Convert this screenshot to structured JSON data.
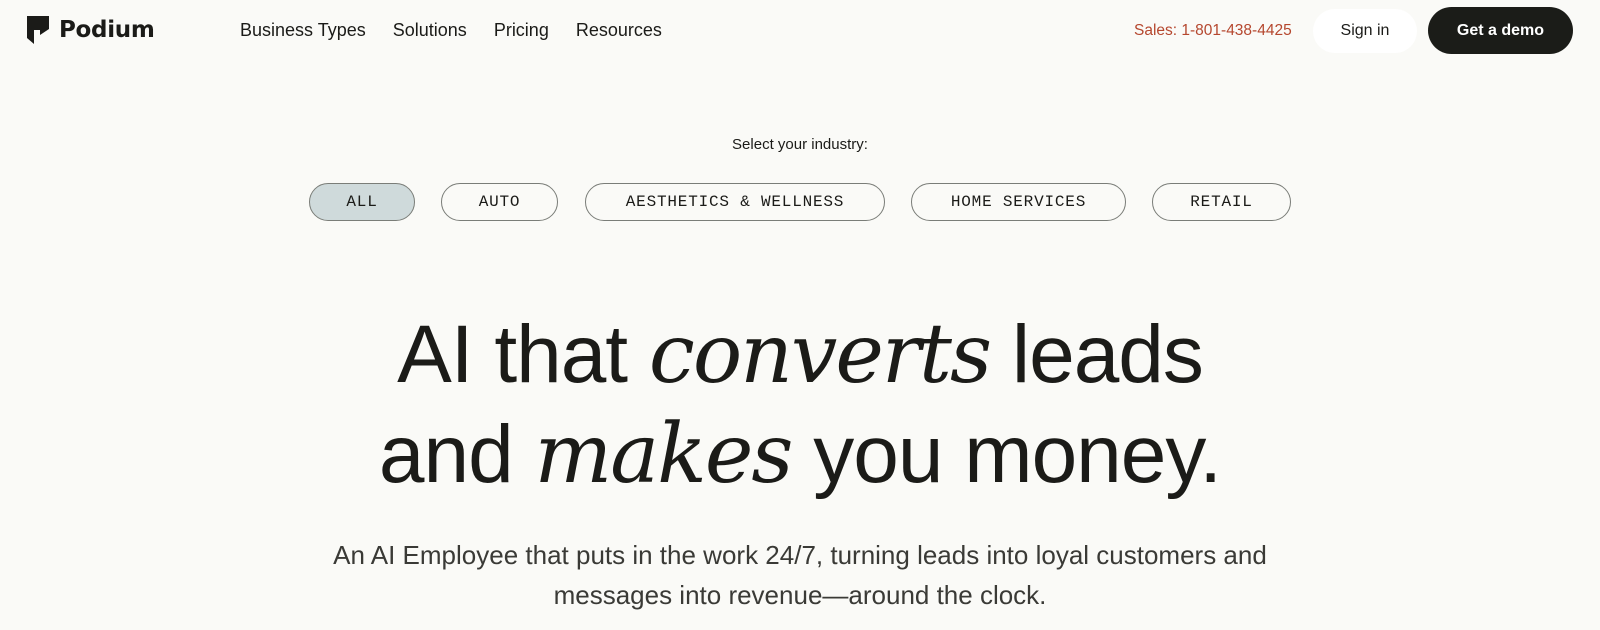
{
  "header": {
    "logo_text": "Podium",
    "nav": [
      "Business Types",
      "Solutions",
      "Pricing",
      "Resources"
    ],
    "sales": "Sales: 1-801-438-4425",
    "signin_label": "Sign in",
    "demo_label": "Get a demo"
  },
  "industry": {
    "label": "Select your industry:",
    "options": [
      "ALL",
      "AUTO",
      "AESTHETICS & WELLNESS",
      "HOME SERVICES",
      "RETAIL"
    ],
    "selected": "ALL"
  },
  "hero": {
    "line1_pre": "AI that ",
    "line1_em": "converts",
    "line1_post": " leads",
    "line2_pre": "and ",
    "line2_em": "makes",
    "line2_post": " you money."
  },
  "subtext": {
    "line1": "An AI Employee that puts in the work 24/7, turning leads into loyal customers and",
    "line2": "messages into revenue—around the clock."
  },
  "colors": {
    "background": "#fafaf7",
    "text": "#1b1b18",
    "sales": "#b5472e",
    "demo_button": "#1b1c18",
    "active_pill": "#cfdadb"
  }
}
